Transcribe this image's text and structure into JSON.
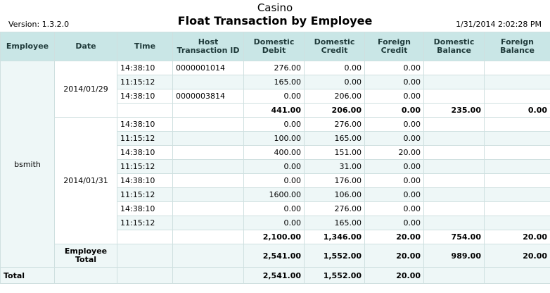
{
  "header": {
    "title": "Casino",
    "subtitle": "Float Transaction by Employee",
    "version": "Version: 1.3.2.0",
    "timestamp": "1/31/2014 2:02:28 PM"
  },
  "columns": [
    "Employee",
    "Date",
    "Time",
    "Host Transaction ID",
    "Domestic Debit",
    "Domestic Credit",
    "Foreign Credit",
    "Domestic Balance",
    "Foreign Balance"
  ],
  "employee": "bsmith",
  "groups": [
    {
      "date": "2014/01/29",
      "rows": [
        {
          "time": "14:38:10",
          "host_id": "0000001014",
          "debit": "276.00",
          "credit": "0.00",
          "foreign_credit": "0.00"
        },
        {
          "time": "11:15:12",
          "host_id": "",
          "debit": "165.00",
          "credit": "0.00",
          "foreign_credit": "0.00"
        },
        {
          "time": "14:38:10",
          "host_id": "0000003814",
          "debit": "0.00",
          "credit": "206.00",
          "foreign_credit": "0.00"
        }
      ],
      "subtotal": {
        "debit": "441.00",
        "credit": "206.00",
        "foreign_credit": "0.00",
        "dom_balance": "235.00",
        "for_balance": "0.00"
      }
    },
    {
      "date": "2014/01/31",
      "rows": [
        {
          "time": "14:38:10",
          "host_id": "",
          "debit": "0.00",
          "credit": "276.00",
          "foreign_credit": "0.00"
        },
        {
          "time": "11:15:12",
          "host_id": "",
          "debit": "100.00",
          "credit": "165.00",
          "foreign_credit": "0.00"
        },
        {
          "time": "14:38:10",
          "host_id": "",
          "debit": "400.00",
          "credit": "151.00",
          "foreign_credit": "20.00"
        },
        {
          "time": "11:15:12",
          "host_id": "",
          "debit": "0.00",
          "credit": "31.00",
          "foreign_credit": "0.00"
        },
        {
          "time": "14:38:10",
          "host_id": "",
          "debit": "0.00",
          "credit": "176.00",
          "foreign_credit": "0.00"
        },
        {
          "time": "11:15:12",
          "host_id": "",
          "debit": "1600.00",
          "credit": "106.00",
          "foreign_credit": "0.00"
        },
        {
          "time": "14:38:10",
          "host_id": "",
          "debit": "0.00",
          "credit": "276.00",
          "foreign_credit": "0.00"
        },
        {
          "time": "11:15:12",
          "host_id": "",
          "debit": "0.00",
          "credit": "165.00",
          "foreign_credit": "0.00"
        }
      ],
      "subtotal": {
        "debit": "2,100.00",
        "credit": "1,346.00",
        "foreign_credit": "20.00",
        "dom_balance": "754.00",
        "for_balance": "20.00"
      }
    }
  ],
  "employee_total": {
    "label": "Employee Total",
    "debit": "2,541.00",
    "credit": "1,552.00",
    "foreign_credit": "20.00",
    "dom_balance": "989.00",
    "for_balance": "20.00"
  },
  "grand_total": {
    "label": "Total",
    "debit": "2,541.00",
    "credit": "1,552.00",
    "foreign_credit": "20.00"
  }
}
